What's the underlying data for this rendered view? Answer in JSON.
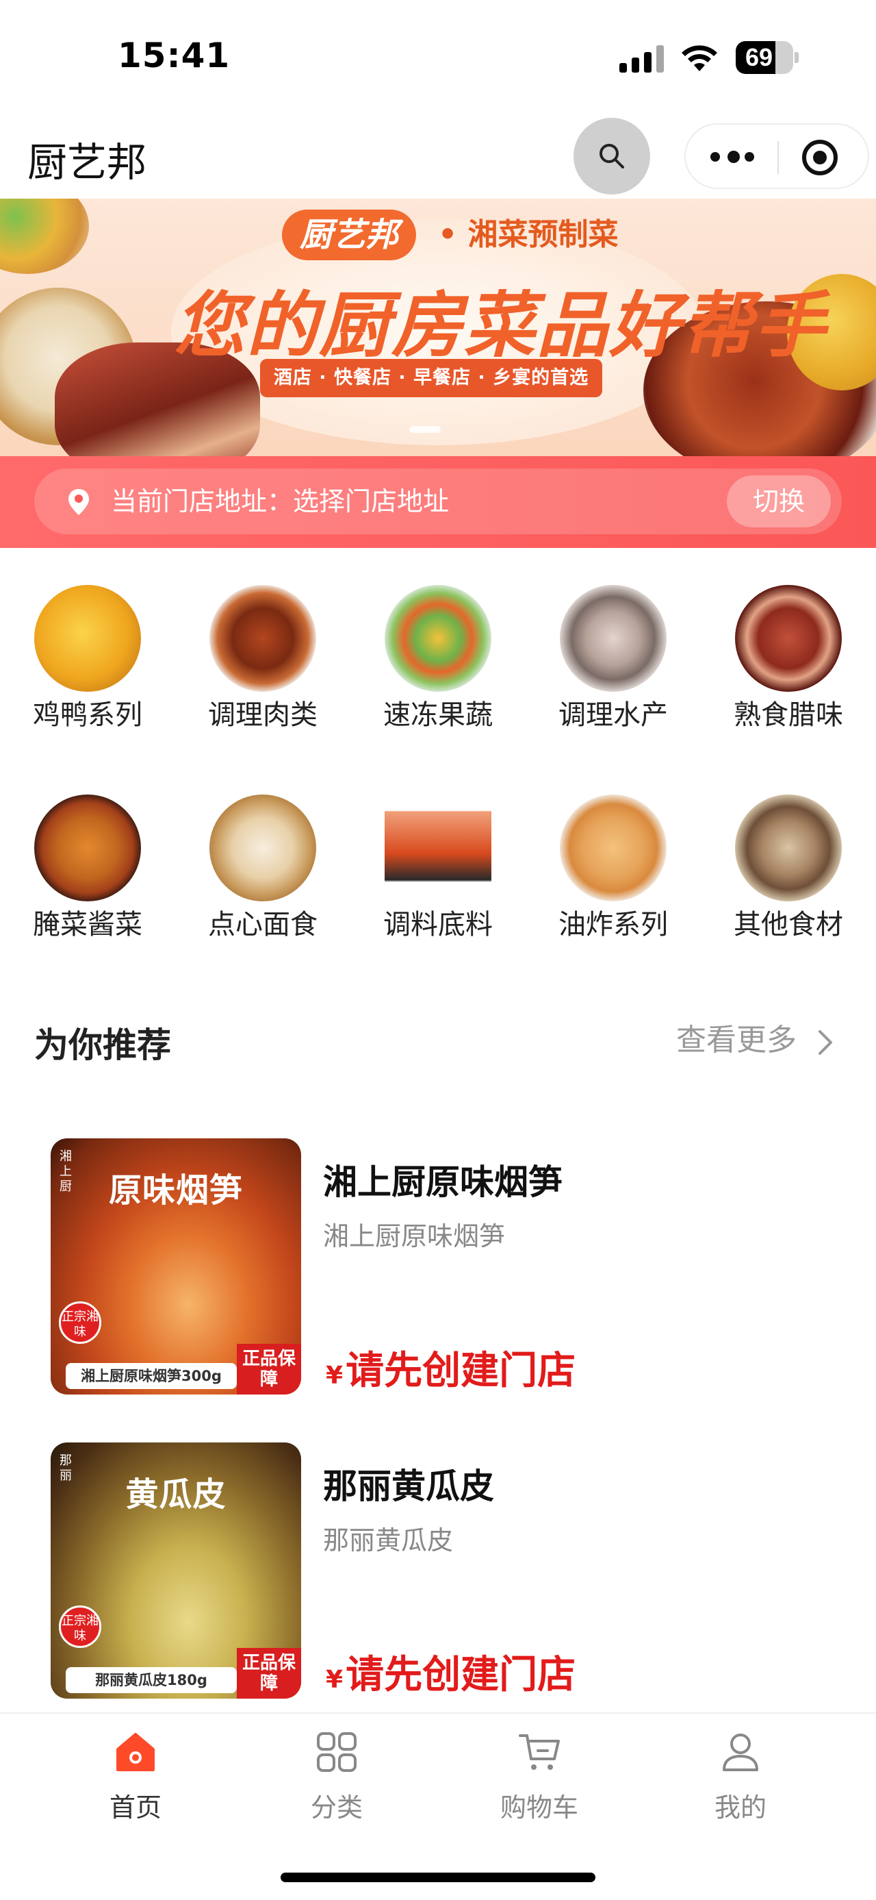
{
  "status_bar": {
    "time": "15:41",
    "battery": "69",
    "battery_level": 0.69
  },
  "nav": {
    "title": "厨艺邦",
    "icons": [
      "search-icon",
      "more-dots-icon",
      "target-icon"
    ]
  },
  "banner": {
    "brand": "厨艺邦",
    "subtitle": "• 湘菜预制菜",
    "headline": "您的厨房菜品好帮手",
    "tagline": "酒店 · 快餐店 · 早餐店 · 乡宴的首选"
  },
  "store": {
    "label": "当前门店地址：选择门店地址",
    "switch_label": "切换",
    "icon": "location-pin-icon"
  },
  "categories": [
    {
      "label": "鸡鸭系列",
      "color": "#f3b020"
    },
    {
      "label": "调理肉类",
      "color": "#a8461f"
    },
    {
      "label": "速冻果蔬",
      "color": "#6fb24a"
    },
    {
      "label": "调理水产",
      "color": "#c9b6ad"
    },
    {
      "label": "熟食腊味",
      "color": "#8e2a1e"
    },
    {
      "label": "腌菜酱菜",
      "color": "#c1661f"
    },
    {
      "label": "点心面食",
      "color": "#e8d0a8"
    },
    {
      "label": "调料底料",
      "color": "#d94a1e"
    },
    {
      "label": "油炸系列",
      "color": "#e6a35a"
    },
    {
      "label": "其他食材",
      "color": "#a88564"
    }
  ],
  "recommend": {
    "title": "为你推荐",
    "more_label": "查看更多"
  },
  "products": [
    {
      "name": "湘上厨原味烟笋",
      "desc": "湘上厨原味烟笋",
      "price_symbol": "¥",
      "price_text": "请先创建门店",
      "thumb": {
        "title": "原味烟笋",
        "side": "湘上厨",
        "seal": "正宗湘味",
        "caption": "湘上厨原味烟笋300g",
        "guarantee": "正品保障",
        "color": "#c2461b"
      }
    },
    {
      "name": "那丽黄瓜皮",
      "desc": "那丽黄瓜皮",
      "price_symbol": "¥",
      "price_text": "请先创建门店",
      "thumb": {
        "title": "黄瓜皮",
        "side": "那丽",
        "seal": "正宗湘味",
        "caption": "那丽黄瓜皮180g",
        "guarantee": "正品保障",
        "color": "#8a6a2a"
      }
    }
  ],
  "tabbar": {
    "tabs": [
      {
        "label": "首页",
        "icon": "home-icon",
        "active": true
      },
      {
        "label": "分类",
        "icon": "grid-icon",
        "active": false
      },
      {
        "label": "购物车",
        "icon": "cart-icon",
        "active": false
      },
      {
        "label": "我的",
        "icon": "user-icon",
        "active": false
      }
    ]
  },
  "colors": {
    "accent": "#ff5a4f",
    "price": "#e21b1b",
    "store_bar": "#fb5a5a"
  }
}
